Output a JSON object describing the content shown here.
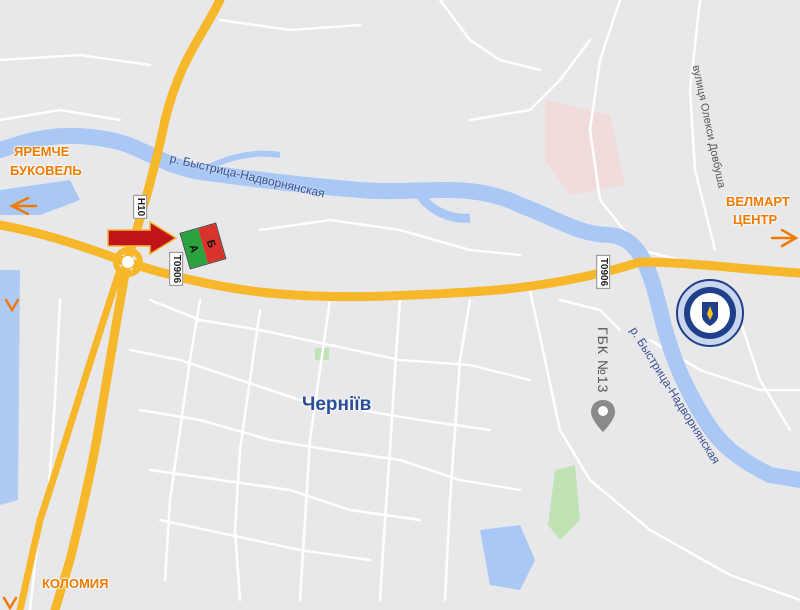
{
  "map": {
    "city_label": "Черніїв",
    "destinations": {
      "yaremche": "ЯРЕМЧЕ",
      "bukovel": "БУКОВЕЛЬ",
      "kolomyia": "КОЛОМИЯ",
      "velmart_line1": "ВЕЛМАРТ",
      "velmart_line2": "ЦЕНТР"
    },
    "road_shields": {
      "h10": "Н10",
      "t0906_west": "Т0906",
      "t0906_east": "Т0906"
    },
    "river_labels": {
      "upper": "р. Быстрица-Надворнянская",
      "lower": "р. Быстрица-Надворнянская"
    },
    "street_label": "вулиця Олекси Довбуша",
    "poi_label": "ГБК №13",
    "marker": {
      "a": "А",
      "b": "Б"
    },
    "colors": {
      "background": "#e8e8ea",
      "water": "#a9c8f5",
      "road": "#f6b82a",
      "minor_road": "#ffffff",
      "park": "#bfe3b5",
      "destination_text": "#f07a00",
      "arrow": "#c0141b"
    },
    "icons": [
      "direction-arrow-icon",
      "location-pin-icon",
      "service-center-emblem-icon",
      "destination-arrow-icon"
    ]
  }
}
